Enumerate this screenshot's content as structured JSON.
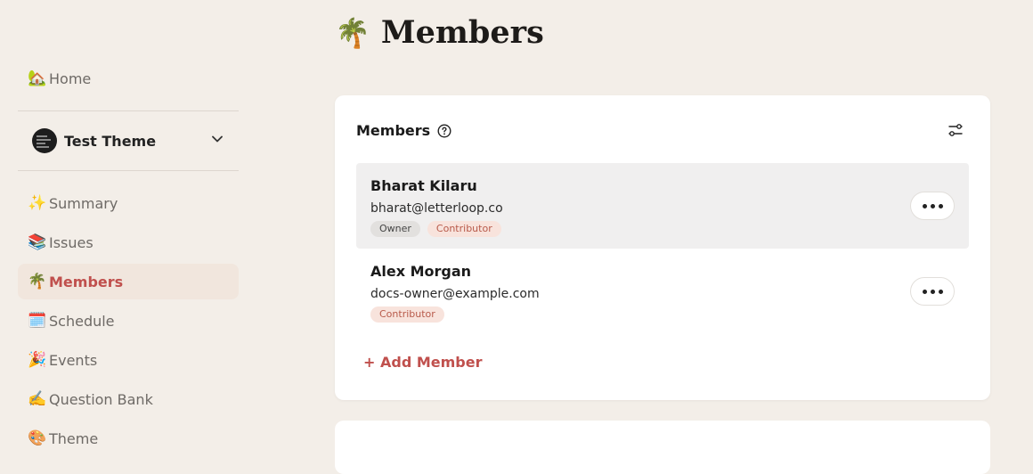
{
  "sidebar": {
    "home": {
      "emoji": "🏡",
      "label": "Home"
    },
    "theme_select": {
      "label": "Test Theme"
    },
    "items": [
      {
        "emoji": "✨",
        "label": "Summary"
      },
      {
        "emoji": "📚",
        "label": "Issues"
      },
      {
        "emoji": "🌴",
        "label": "Members"
      },
      {
        "emoji": "🗓️",
        "label": "Schedule"
      },
      {
        "emoji": "🎉",
        "label": "Events"
      },
      {
        "emoji": "✍️",
        "label": "Question Bank"
      },
      {
        "emoji": "🎨",
        "label": "Theme"
      }
    ],
    "active_item": "Members"
  },
  "page": {
    "emoji": "🌴",
    "title": "Members"
  },
  "members_card": {
    "title": "Members",
    "add_label": "+ Add Member",
    "members": [
      {
        "name": "Bharat Kilaru",
        "email": "bharat@letterloop.co",
        "roles": [
          "Owner",
          "Contributor"
        ]
      },
      {
        "name": "Alex Morgan",
        "email": "docs-owner@example.com",
        "roles": [
          "Contributor"
        ]
      }
    ]
  },
  "colors": {
    "accent": "#c0504d",
    "background": "#f3eee8",
    "card": "#ffffff"
  }
}
